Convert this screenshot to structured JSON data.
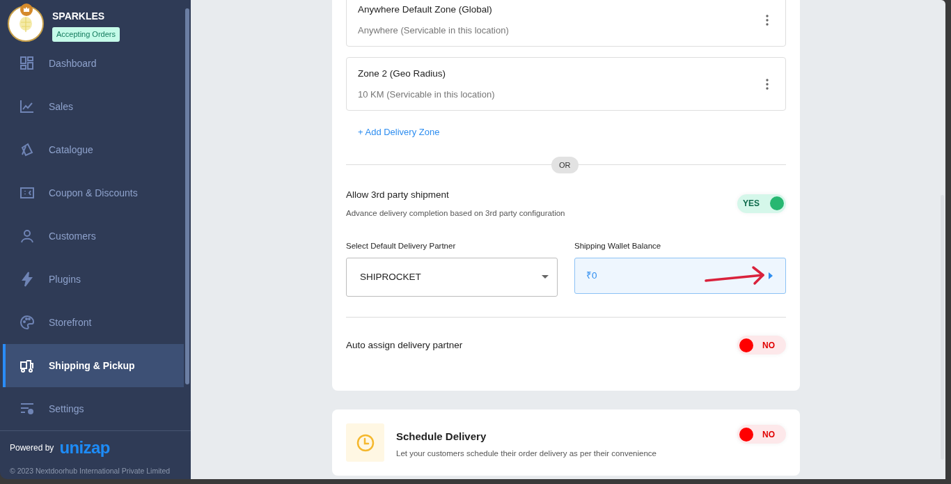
{
  "store": {
    "name": "SPARKLES",
    "status_badge": "Accepting Orders"
  },
  "nav": {
    "items": [
      {
        "label": "Dashboard",
        "selected": false
      },
      {
        "label": "Sales",
        "selected": false
      },
      {
        "label": "Catalogue",
        "selected": false
      },
      {
        "label": "Coupon & Discounts",
        "selected": false
      },
      {
        "label": "Customers",
        "selected": false
      },
      {
        "label": "Plugins",
        "selected": false
      },
      {
        "label": "Storefront",
        "selected": false
      },
      {
        "label": "Shipping & Pickup",
        "selected": true
      },
      {
        "label": "Settings",
        "selected": false
      }
    ]
  },
  "footer": {
    "powered_by": "Powered by",
    "brand": "unizap",
    "copyright": "© 2023 Nextdoorhub International Private Limited"
  },
  "zones": [
    {
      "title": "Anywhere Default Zone (Global)",
      "subtitle": "Anywhere (Servicable in this location)"
    },
    {
      "title": "Zone 2 (Geo Radius)",
      "subtitle": "10 KM (Servicable in this location)"
    }
  ],
  "add_zone_label": "+ Add Delivery Zone",
  "divider_label": "OR",
  "third_party": {
    "title": "Allow 3rd party shipment",
    "description": "Advance delivery completion based on 3rd party configuration",
    "on": true,
    "toggle_label": "YES"
  },
  "partner": {
    "label": "Select Default Delivery Partner",
    "value": "SHIPROCKET"
  },
  "wallet": {
    "label": "Shipping Wallet Balance",
    "value": "₹0"
  },
  "auto_assign": {
    "title": "Auto assign delivery partner",
    "on": false,
    "toggle_label": "NO"
  },
  "schedule": {
    "title": "Schedule Delivery",
    "description": "Let your customers schedule their order delivery as per their convenience",
    "on": false,
    "toggle_label": "NO"
  }
}
